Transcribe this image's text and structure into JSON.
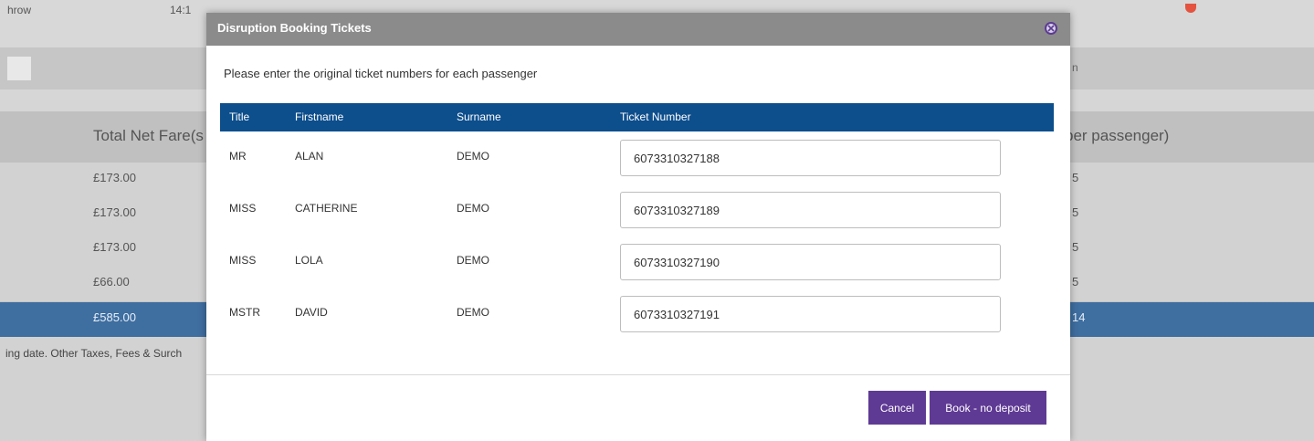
{
  "background": {
    "top_left_text": "hrow",
    "top_time_text": "14:1",
    "searchbar_right_text": "n",
    "header_left": "Total Net Fare(s",
    "header_right": "per passenger)",
    "rows": [
      {
        "left": "£173.00",
        "right": "5"
      },
      {
        "left": "£173.00",
        "right": "5"
      },
      {
        "left": "£173.00",
        "right": "5"
      },
      {
        "left": "£66.00",
        "right": "5"
      },
      {
        "left": "£585.00",
        "right": "14"
      }
    ],
    "footnote": "ing date. Other Taxes, Fees & Surch"
  },
  "modal": {
    "title": "Disruption Booking Tickets",
    "instruction": "Please enter the original ticket numbers for each passenger",
    "columns": {
      "title": "Title",
      "firstname": "Firstname",
      "surname": "Surname",
      "ticket": "Ticket Number"
    },
    "passengers": [
      {
        "title": "MR",
        "firstname": "ALAN",
        "surname": "DEMO",
        "ticket": "6073310327188"
      },
      {
        "title": "MISS",
        "firstname": "CATHERINE",
        "surname": "DEMO",
        "ticket": "6073310327189"
      },
      {
        "title": "MISS",
        "firstname": "LOLA",
        "surname": "DEMO",
        "ticket": "6073310327190"
      },
      {
        "title": "MSTR",
        "firstname": "DAVID",
        "surname": "DEMO",
        "ticket": "6073310327191"
      }
    ],
    "buttons": {
      "cancel": "Cancel",
      "book": "Book - no deposit"
    }
  },
  "colors": {
    "modal_header": "#8b8b8b",
    "table_header": "#0d4e8c",
    "button": "#5f3a94",
    "total_row": "#3f6ea0"
  },
  "icons": {
    "close": "close-circle-icon"
  }
}
